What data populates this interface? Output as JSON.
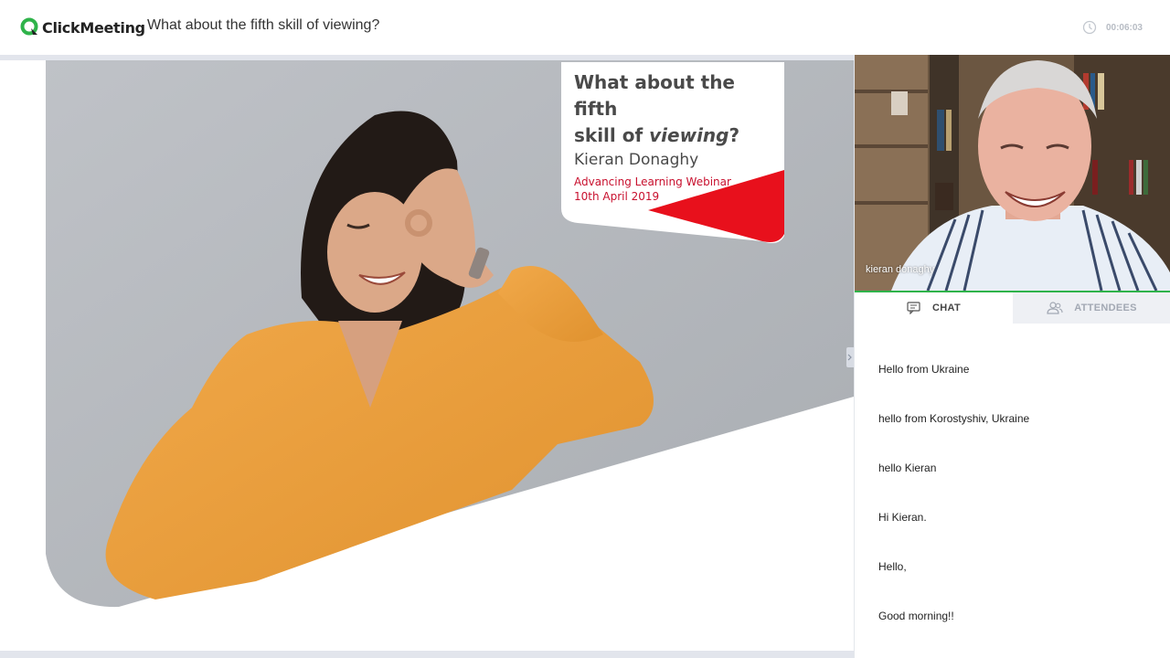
{
  "header": {
    "brand": "ClickMeeting",
    "meeting_title": "What about the fifth skill of viewing?",
    "timer": "00:06:03"
  },
  "slide": {
    "title_line1": "What about the fifth",
    "title_line2_prefix": "skill of ",
    "title_line2_italic": "viewing",
    "title_line2_suffix": "?",
    "author": "Kieran Donaghy",
    "event": "Advancing Learning Webinar",
    "date": "10th April 2019",
    "accent_color": "#e8101c"
  },
  "video": {
    "participant_name": "kieran donaghy"
  },
  "tabs": [
    {
      "label": "CHAT",
      "icon": "chat-icon",
      "active": true
    },
    {
      "label": "ATTENDEES",
      "icon": "attendees-icon",
      "active": false
    }
  ],
  "chat": {
    "messages": [
      "Hello from Ukraine",
      "hello from Korostyshiv, Ukraine",
      "hello Kieran",
      "Hi Kieran.",
      "Hello,",
      "Good morning!!"
    ]
  },
  "colors": {
    "brand_green": "#2fb34a",
    "tab_inactive_bg": "#eef0f4"
  }
}
